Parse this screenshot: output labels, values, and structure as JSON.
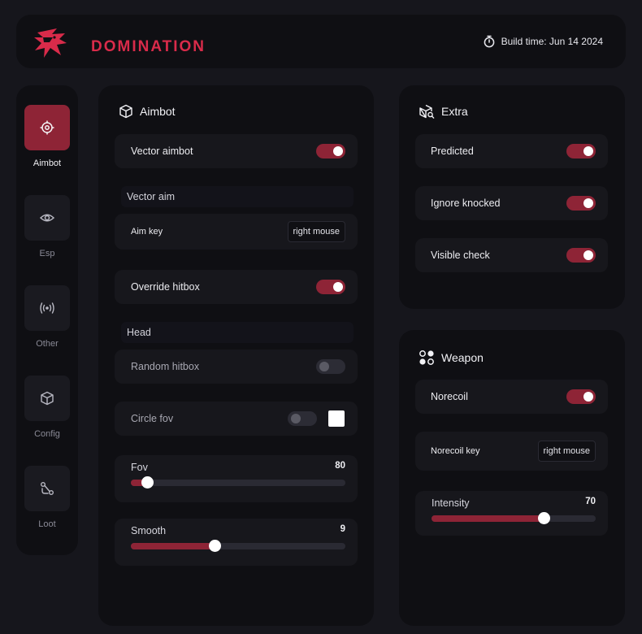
{
  "header": {
    "brand": "DOMINATION",
    "build_time": "Build time: Jun 14 2024"
  },
  "sidebar": {
    "items": [
      {
        "label": "Aimbot",
        "icon": "crosshair-icon",
        "active": true
      },
      {
        "label": "Esp",
        "icon": "eye-icon",
        "active": false
      },
      {
        "label": "Other",
        "icon": "radio-icon",
        "active": false
      },
      {
        "label": "Config",
        "icon": "box-icon",
        "active": false
      },
      {
        "label": "Loot",
        "icon": "route-icon",
        "active": false
      }
    ]
  },
  "aimbot": {
    "title": "Aimbot",
    "vector_aimbot": {
      "label": "Vector aimbot",
      "on": true
    },
    "vector_aim_section": "Vector aim",
    "aim_key": {
      "label": "Aim key",
      "value": "right mouse"
    },
    "override_hitbox": {
      "label": "Override hitbox",
      "on": true
    },
    "hitbox_section": "Head",
    "random_hitbox": {
      "label": "Random hitbox",
      "on": false
    },
    "circle_fov": {
      "label": "Circle fov",
      "on": false,
      "color": "#ffffff"
    },
    "fov": {
      "label": "Fov",
      "value": 80,
      "fraction": 0.075
    },
    "smooth": {
      "label": "Smooth",
      "value": 9,
      "fraction": 0.39
    }
  },
  "extra": {
    "title": "Extra",
    "predicted": {
      "label": "Predicted",
      "on": true
    },
    "ignore_knocked": {
      "label": "Ignore knocked",
      "on": true
    },
    "visible_check": {
      "label": "Visible check",
      "on": true
    }
  },
  "weapon": {
    "title": "Weapon",
    "norecoil": {
      "label": "Norecoil",
      "on": true
    },
    "norecoil_key": {
      "label": "Norecoil key",
      "value": "right mouse"
    },
    "intensity": {
      "label": "Intensity",
      "value": 70,
      "fraction": 0.685
    }
  },
  "colors": {
    "accent": "#8e2436",
    "brand": "#d92b4a",
    "background": "#16161c",
    "panel": "#0f0f13",
    "row": "#17171c"
  }
}
